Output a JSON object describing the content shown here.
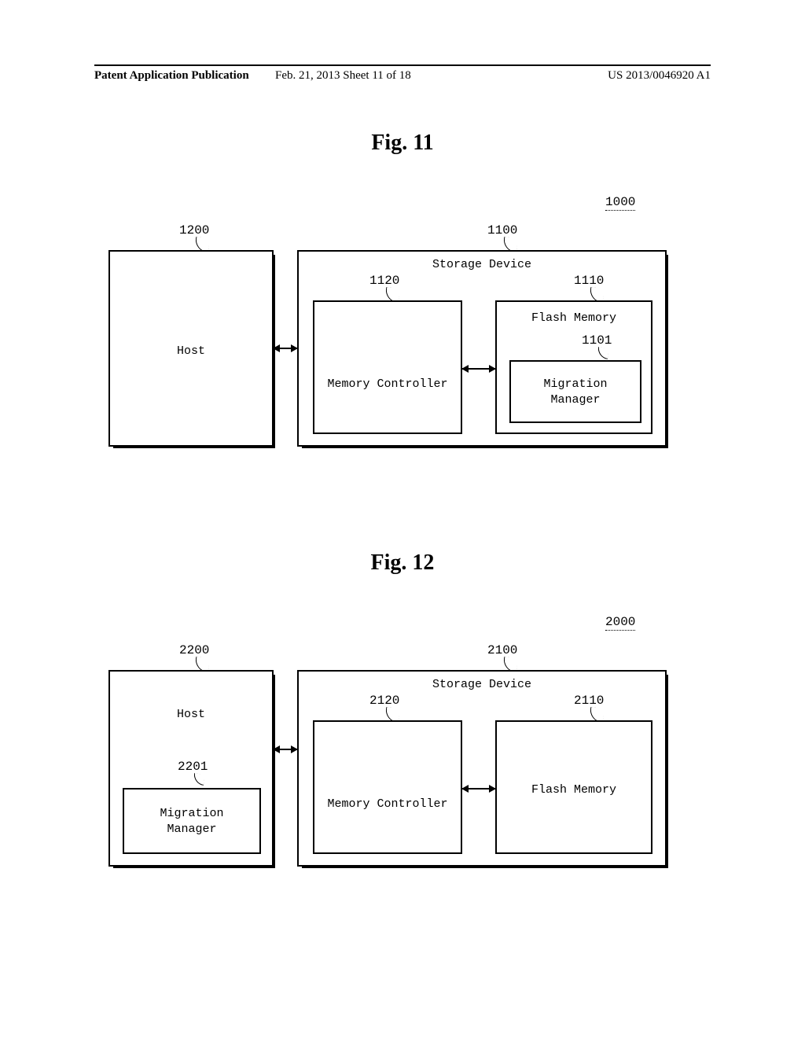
{
  "header": {
    "left": "Patent Application Publication",
    "mid": "Feb. 21, 2013  Sheet 11 of 18",
    "right": "US 2013/0046920 A1"
  },
  "fig11": {
    "title": "Fig. 11",
    "system_ref": "1000",
    "host_ref": "1200",
    "host_label": "Host",
    "storage_ref": "1100",
    "storage_label": "Storage Device",
    "memctrl_ref": "1120",
    "memctrl_label": "Memory Controller",
    "flash_ref": "1110",
    "flash_label": "Flash Memory",
    "mig_ref": "1101",
    "mig_label_l1": "Migration",
    "mig_label_l2": "Manager"
  },
  "fig12": {
    "title": "Fig. 12",
    "system_ref": "2000",
    "host_ref": "2200",
    "host_label": "Host",
    "storage_ref": "2100",
    "storage_label": "Storage Device",
    "memctrl_ref": "2120",
    "memctrl_label": "Memory Controller",
    "flash_ref": "2110",
    "flash_label": "Flash Memory",
    "mig_ref": "2201",
    "mig_label_l1": "Migration",
    "mig_label_l2": "Manager"
  }
}
